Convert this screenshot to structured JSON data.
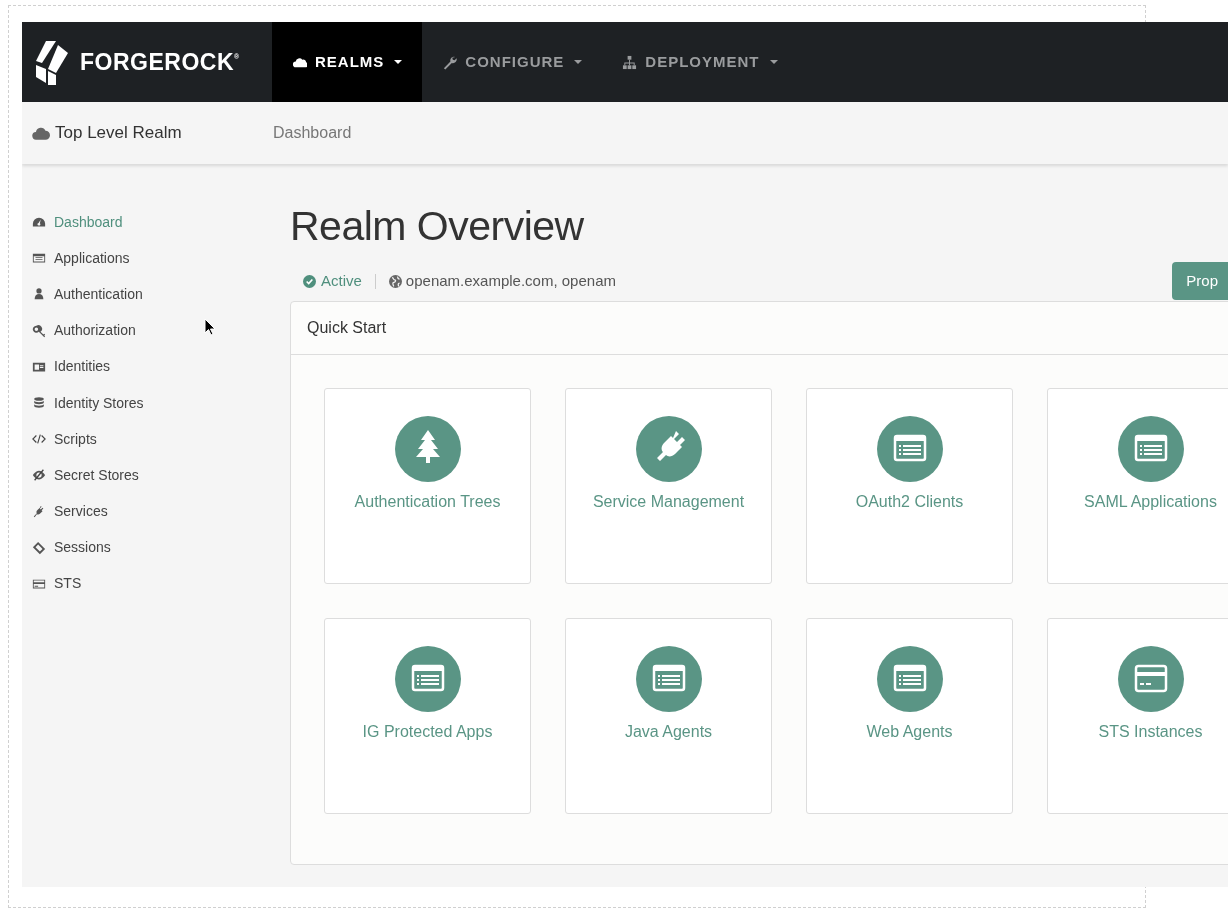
{
  "brand": {
    "name": "FORGEROCK$^{®}$"
  },
  "nav": [
    {
      "label": "REALMS",
      "selected": true
    },
    {
      "label": "CONFIGURE",
      "selected": false
    },
    {
      "label": "DEPLOYMENT",
      "selected": false
    }
  ],
  "subheader": {
    "realm": "Top Level Realm",
    "breadcrumb": "Dashboard"
  },
  "sidebar": {
    "items": [
      {
        "label": "Dashboard",
        "selected": true
      },
      {
        "label": "Applications",
        "selected": false
      },
      {
        "label": "Authentication",
        "selected": false
      },
      {
        "label": "Authorization",
        "selected": false
      },
      {
        "label": "Identities",
        "selected": false
      },
      {
        "label": "Identity Stores",
        "selected": false
      },
      {
        "label": "Scripts",
        "selected": false
      },
      {
        "label": "Secret Stores",
        "selected": false
      },
      {
        "label": "Services",
        "selected": false
      },
      {
        "label": "Sessions",
        "selected": false
      },
      {
        "label": "STS",
        "selected": false
      }
    ]
  },
  "page": {
    "title": "Realm Overview",
    "status": "Active",
    "hosts": "openam.example.com, openam",
    "button": "Prop"
  },
  "quick_start": {
    "title": "Quick Start",
    "tiles": [
      {
        "label": "Authentication Trees"
      },
      {
        "label": "Service Management"
      },
      {
        "label": "OAuth2 Clients"
      },
      {
        "label": "SAML Applications"
      },
      {
        "label": "IG Protected Apps"
      },
      {
        "label": "Java Agents"
      },
      {
        "label": "Web Agents"
      },
      {
        "label": "STS Instances"
      }
    ]
  }
}
